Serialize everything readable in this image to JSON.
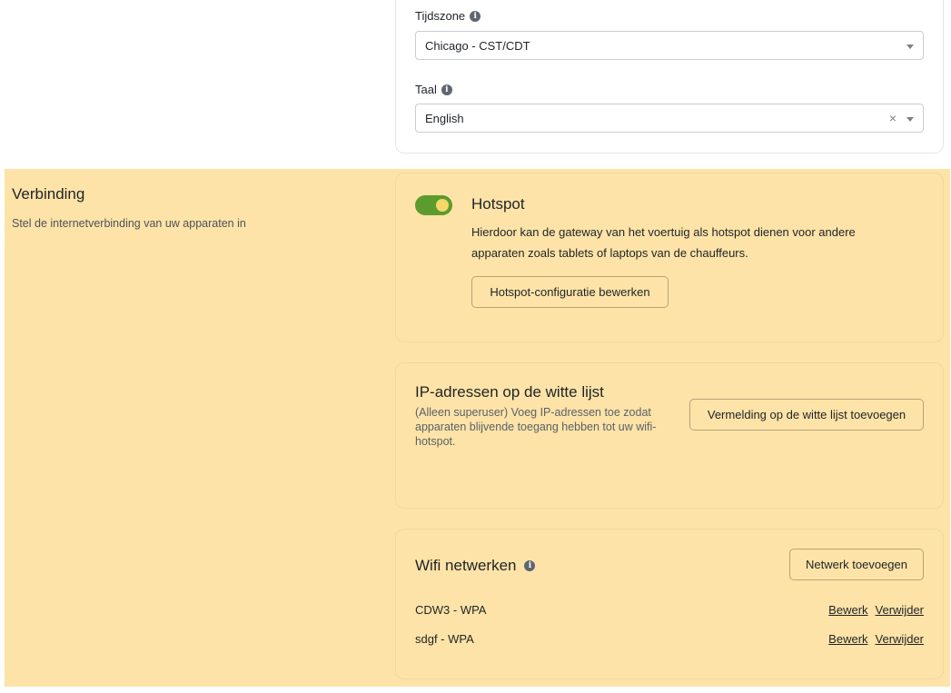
{
  "general": {
    "timezone": {
      "label": "Tijdszone",
      "value": "Chicago - CST/CDT"
    },
    "language": {
      "label": "Taal",
      "value": "English",
      "clear_glyph": "×"
    }
  },
  "connection": {
    "title": "Verbinding",
    "subtitle": "Stel de internetverbinding van uw apparaten in",
    "hotspot": {
      "enabled": true,
      "title": "Hotspot",
      "description": "Hierdoor kan de gateway van het voertuig als hotspot dienen voor andere apparaten zoals tablets of laptops van de chauffeurs.",
      "edit_button": "Hotspot-configuratie bewerken"
    },
    "whitelist": {
      "title": "IP-adressen op de witte lijst",
      "description": "(Alleen superuser) Voeg IP-adressen toe zodat apparaten blijvende toegang hebben tot uw wifi-hotspot.",
      "add_button": "Vermelding op de witte lijst toevoegen"
    },
    "wifi": {
      "title": "Wifi netwerken",
      "add_button": "Netwerk toevoegen",
      "edit_label": "Bewerk",
      "delete_label": "Verwijder",
      "networks": [
        {
          "name": "CDW3 - WPA"
        },
        {
          "name": "sdgf - WPA"
        }
      ]
    }
  },
  "colors": {
    "section_highlight": "#fde3a7",
    "toggle_on": "#5c9b2e",
    "toggle_knob": "#f6d76a"
  }
}
